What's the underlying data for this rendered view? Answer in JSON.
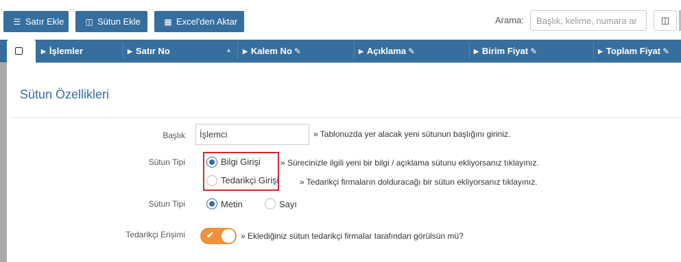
{
  "toolbar": {
    "add_row": {
      "label": "Satır Ekle",
      "icon": "list-icon"
    },
    "add_column": {
      "label": "Sütun Ekle",
      "icon": "columns-icon"
    },
    "import_excel": {
      "label": "Excel'den Aktar",
      "icon": "excel-icon"
    },
    "search_label": "Arama:",
    "search_placeholder": "Başlık, kelime, numara ar",
    "column_toggle_icon": "columns-icon"
  },
  "table": {
    "headers": [
      {
        "label": "İşlemler",
        "editable": false,
        "sortable": false
      },
      {
        "label": "Satır No",
        "editable": false,
        "sortable": true
      },
      {
        "label": "Kalem No",
        "editable": true,
        "sortable": false
      },
      {
        "label": "Açıklama",
        "editable": true,
        "sortable": false
      },
      {
        "label": "Birim Fiyat",
        "editable": true,
        "sortable": false
      },
      {
        "label": "Toplam Fiyat",
        "editable": true,
        "sortable": false
      }
    ]
  },
  "panel": {
    "title": "Sütun Özellikleri",
    "title_field": {
      "label": "Başlık",
      "value": "İşlemci",
      "help": "» Tablonuzda yer alacak yeni sütunun başlığını giriniz."
    },
    "column_type": {
      "label": "Sütun Tipi",
      "options": [
        {
          "label": "Bilgi Girişi",
          "selected": true,
          "help": "» Sürecinizle ilgili yeni bir bilgi / açıklama sütunu ekliyorsanız tıklayınız."
        },
        {
          "label": "Tedarikçi Girişi",
          "selected": false,
          "help": "» Tedarikçi firmaların dolduracağı bir sütun ekliyorsanız tıklayınız."
        }
      ]
    },
    "data_type": {
      "label": "Sütun Tipi",
      "options": [
        {
          "label": "Metin",
          "selected": true
        },
        {
          "label": "Sayı",
          "selected": false
        }
      ]
    },
    "supplier_access": {
      "label": "Tedarikçi Erişimi",
      "enabled": true,
      "help": "» Eklediğiniz sütun tedarikçi firmalar tarafından görülsün mü?"
    }
  },
  "colors": {
    "primary": "#366e9e",
    "toggle_on": "#f0903a",
    "highlight_box": "#d9232e",
    "overlay": "#a9a9a9"
  }
}
